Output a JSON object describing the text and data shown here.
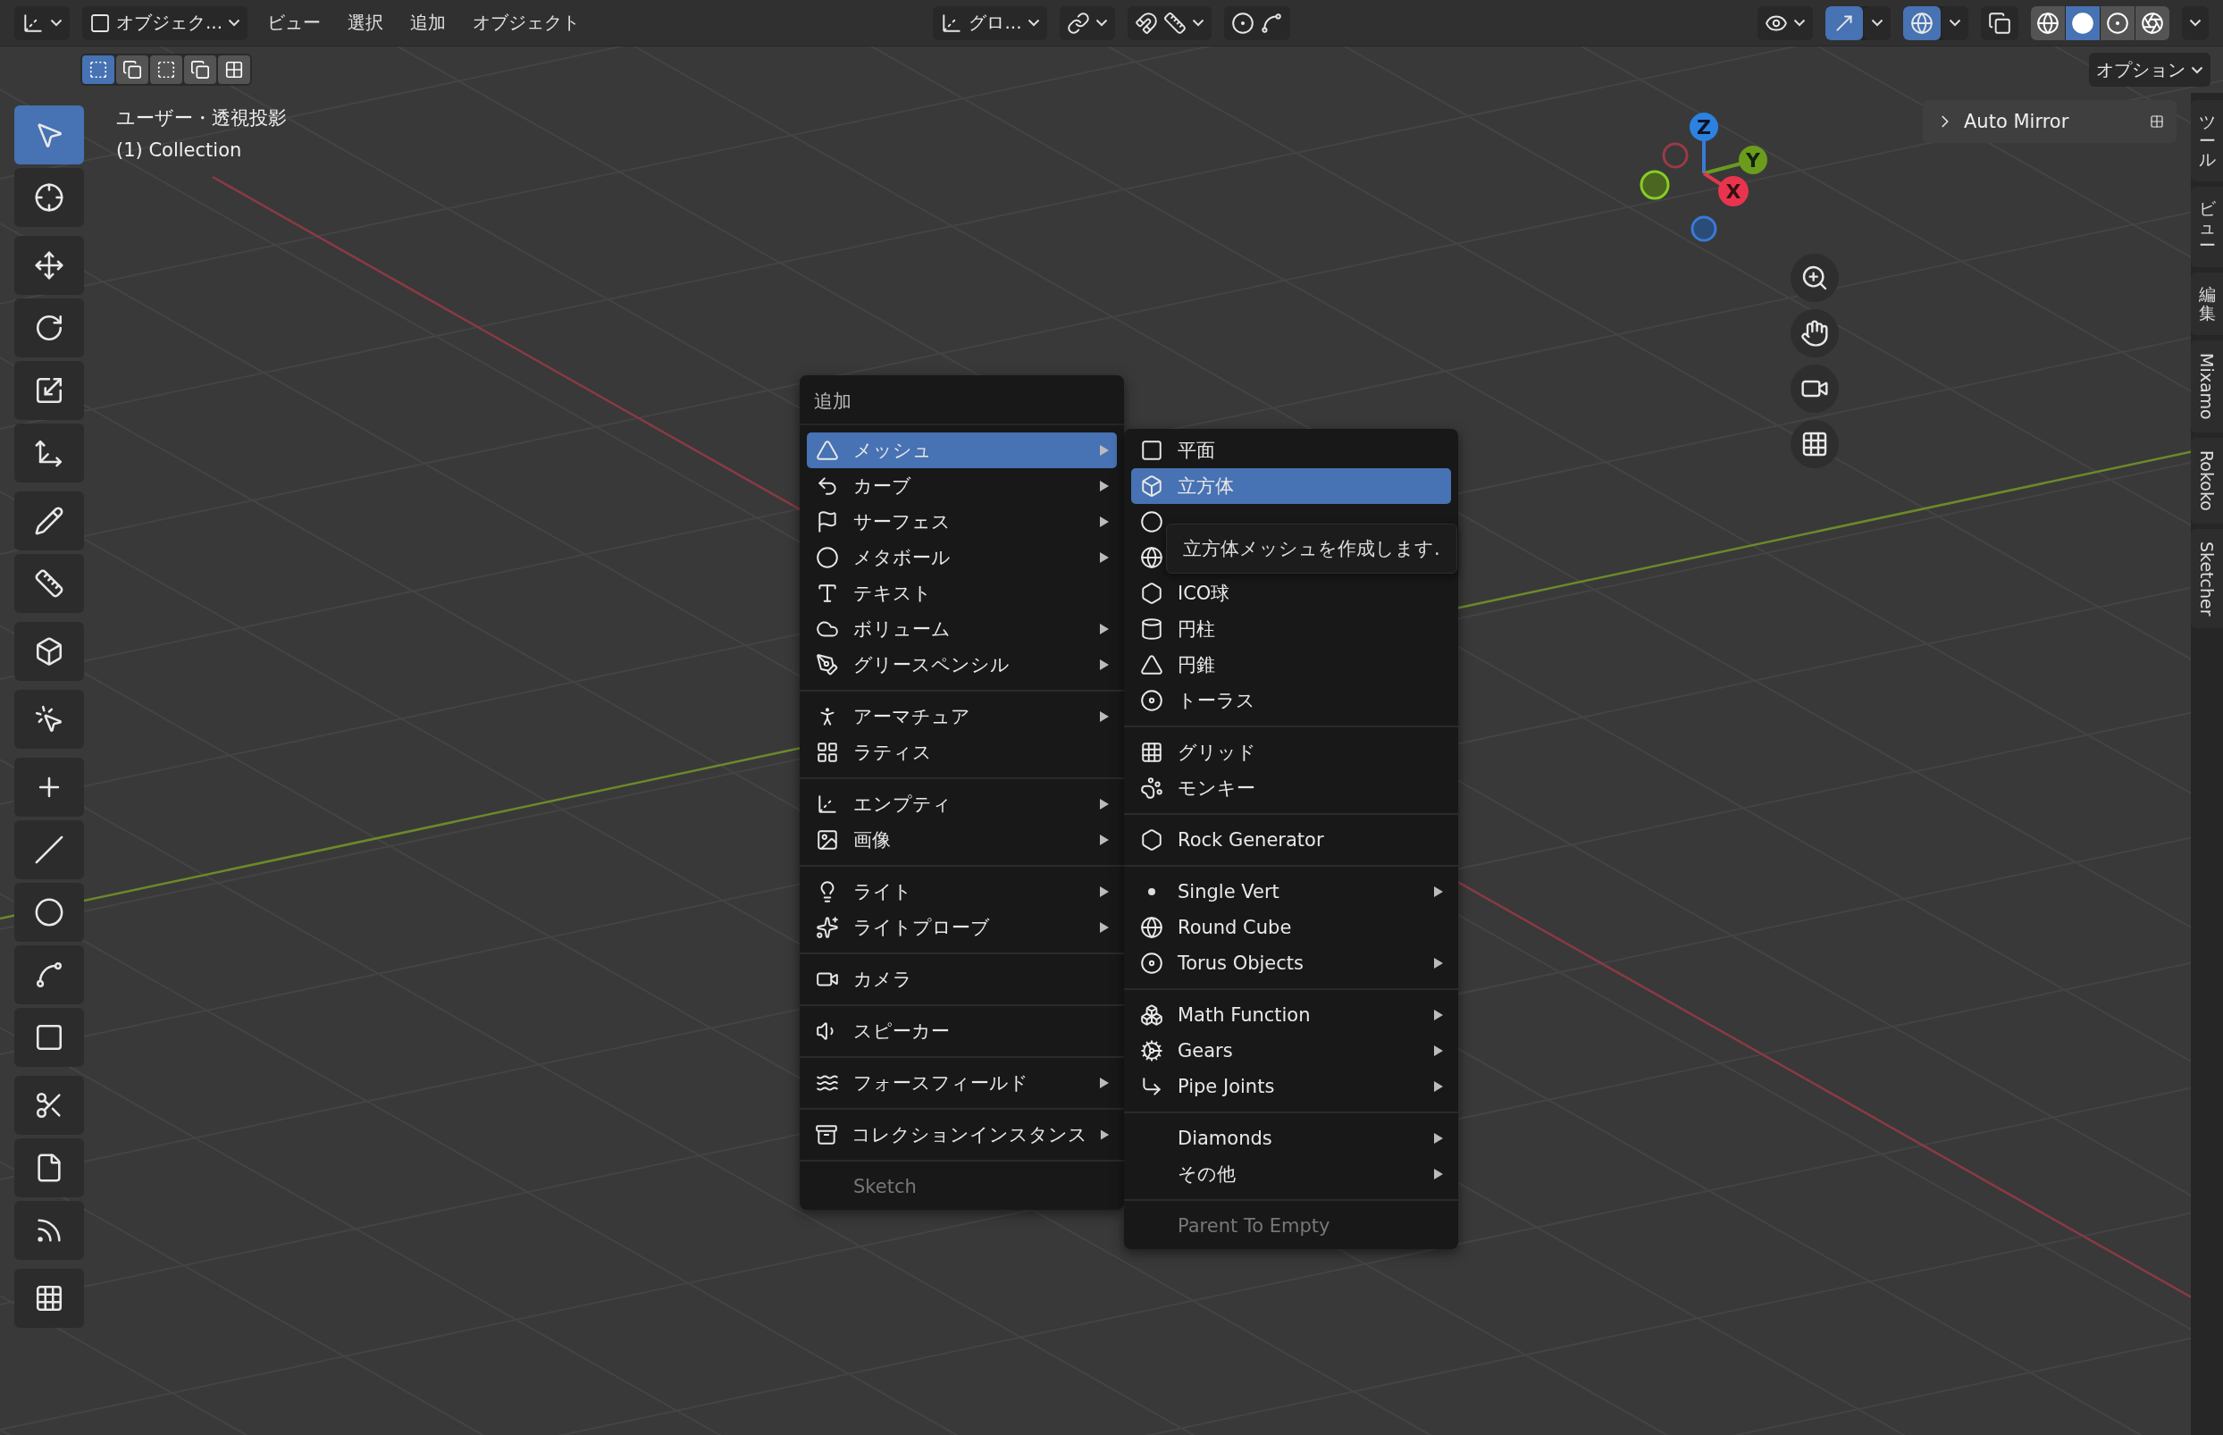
{
  "header": {
    "mode": "オブジェク...",
    "menus": [
      "ビュー",
      "選択",
      "追加",
      "オブジェクト"
    ],
    "orientation": "グロ...",
    "snap": {
      "on": false
    },
    "proportional": {
      "on": false
    },
    "gizmo_toggle": {
      "on": true
    },
    "overlay_toggle": {
      "on": true
    },
    "xray": {
      "on": false
    },
    "shading": [
      {
        "selected": false
      },
      {
        "selected": true
      },
      {
        "selected": false
      },
      {
        "selected": false
      }
    ]
  },
  "select_modes": [
    {
      "selected": true
    },
    {
      "selected": false
    },
    {
      "selected": false
    },
    {
      "selected": false
    },
    {
      "selected": false
    }
  ],
  "options": "オプション",
  "viewport": {
    "view_name": "ユーザー・透視投影",
    "collection": "(1) Collection"
  },
  "tools": [
    [
      {
        "selected": true
      },
      {
        "selected": false
      }
    ],
    [
      {
        "selected": false
      },
      {
        "selected": false
      },
      {
        "selected": false
      },
      {
        "selected": false
      }
    ],
    [
      {
        "selected": false
      },
      {
        "selected": false
      }
    ],
    [
      {
        "selected": false
      }
    ],
    [
      {
        "selected": false
      }
    ],
    [
      {
        "selected": false
      },
      {
        "selected": false
      },
      {
        "selected": false
      },
      {
        "selected": false
      },
      {
        "selected": false
      }
    ],
    [
      {
        "selected": false
      },
      {
        "selected": false
      },
      {
        "selected": false
      }
    ],
    [
      {
        "selected": false
      }
    ]
  ],
  "gizmo": {
    "axes": [
      "Z",
      "Y",
      "X"
    ]
  },
  "panel": {
    "title": "Auto Mirror",
    "expanded": false
  },
  "side_tabs": [
    {
      "label": "ツール",
      "kind": "cjk"
    },
    {
      "label": "ビュー",
      "kind": "cjk"
    },
    {
      "label": "編集",
      "kind": "cjk"
    },
    {
      "label": "Mixamo",
      "kind": "latin"
    },
    {
      "label": "Rokoko",
      "kind": "latin"
    },
    {
      "label": "Sketcher",
      "kind": "latin"
    }
  ],
  "add_menu": {
    "title": "追加",
    "groups": [
      [
        {
          "label": "メッシュ",
          "selected": true,
          "arrow": true,
          "disabled": false
        },
        {
          "label": "カーブ",
          "selected": false,
          "arrow": true,
          "disabled": false
        },
        {
          "label": "サーフェス",
          "selected": false,
          "arrow": true,
          "disabled": false
        },
        {
          "label": "メタボール",
          "selected": false,
          "arrow": true,
          "disabled": false
        },
        {
          "label": "テキスト",
          "selected": false,
          "arrow": false,
          "disabled": false
        },
        {
          "label": "ボリューム",
          "selected": false,
          "arrow": true,
          "disabled": false
        },
        {
          "label": "グリースペンシル",
          "selected": false,
          "arrow": true,
          "disabled": false
        }
      ],
      [
        {
          "label": "アーマチュア",
          "selected": false,
          "arrow": true,
          "disabled": false
        },
        {
          "label": "ラティス",
          "selected": false,
          "arrow": false,
          "disabled": false
        }
      ],
      [
        {
          "label": "エンプティ",
          "selected": false,
          "arrow": true,
          "disabled": false
        },
        {
          "label": "画像",
          "selected": false,
          "arrow": true,
          "disabled": false
        }
      ],
      [
        {
          "label": "ライト",
          "selected": false,
          "arrow": true,
          "disabled": false
        },
        {
          "label": "ライトプローブ",
          "selected": false,
          "arrow": true,
          "disabled": false
        }
      ],
      [
        {
          "label": "カメラ",
          "selected": false,
          "arrow": false,
          "disabled": false
        }
      ],
      [
        {
          "label": "スピーカー",
          "selected": false,
          "arrow": false,
          "disabled": false
        }
      ],
      [
        {
          "label": "フォースフィールド",
          "selected": false,
          "arrow": true,
          "disabled": false
        }
      ],
      [
        {
          "label": "コレクションインスタンス",
          "selected": false,
          "arrow": true,
          "disabled": false
        }
      ],
      [
        {
          "label": "Sketch",
          "selected": false,
          "arrow": false,
          "disabled": true
        }
      ]
    ]
  },
  "mesh_menu": {
    "groups": [
      [
        {
          "label": "平面",
          "selected": false,
          "arrow": false,
          "disabled": false
        },
        {
          "label": "立方体",
          "selected": true,
          "arrow": false,
          "disabled": false
        },
        {
          "selected": false,
          "arrow": false,
          "disabled": false
        },
        {
          "selected": false,
          "disabled": false
        },
        {
          "label": "ICO球",
          "selected": false,
          "arrow": false,
          "disabled": false
        },
        {
          "label": "円柱",
          "selected": false,
          "arrow": false,
          "disabled": false
        },
        {
          "label": "円錐",
          "selected": false,
          "arrow": false,
          "disabled": false
        },
        {
          "label": "トーラス",
          "selected": false,
          "arrow": false,
          "disabled": false
        }
      ],
      [
        {
          "label": "グリッド",
          "selected": false,
          "arrow": false,
          "disabled": false
        },
        {
          "label": "モンキー",
          "selected": false,
          "arrow": false,
          "disabled": false
        }
      ],
      [
        {
          "label": "Rock Generator",
          "selected": false,
          "arrow": false,
          "disabled": false
        }
      ],
      [
        {
          "label": "Single Vert",
          "selected": false,
          "arrow": true,
          "disabled": false
        },
        {
          "label": "Round Cube",
          "selected": false,
          "arrow": false,
          "disabled": false
        },
        {
          "label": "Torus Objects",
          "selected": false,
          "arrow": true,
          "disabled": false
        }
      ],
      [
        {
          "label": "Math Function",
          "selected": false,
          "arrow": true,
          "disabled": false
        },
        {
          "label": "Gears",
          "selected": false,
          "arrow": true,
          "disabled": false
        },
        {
          "label": "Pipe Joints",
          "selected": false,
          "arrow": true,
          "disabled": false
        }
      ],
      [
        {
          "label": "Diamonds",
          "selected": false,
          "arrow": true,
          "disabled": false
        },
        {
          "label": "その他",
          "selected": false,
          "arrow": true,
          "disabled": false
        }
      ],
      [
        {
          "label": "Parent To Empty",
          "selected": false,
          "arrow": false,
          "disabled": true
        }
      ]
    ]
  },
  "tooltip": "立方体メッシュを作成します."
}
